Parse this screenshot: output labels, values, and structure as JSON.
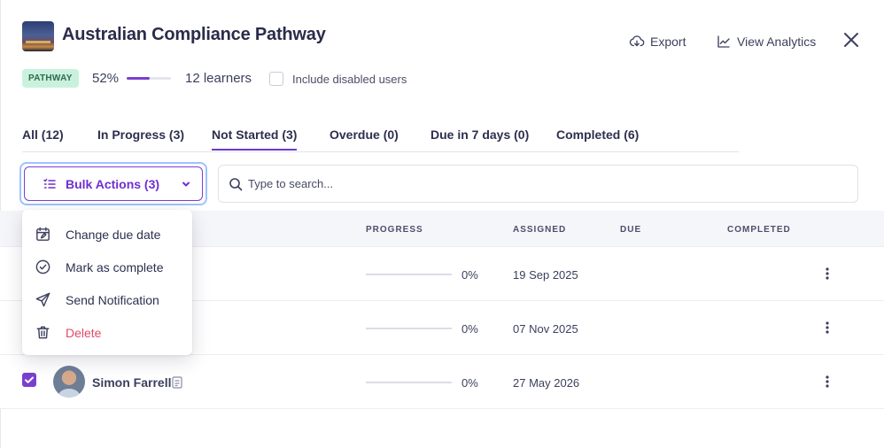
{
  "header": {
    "title": "Australian Compliance Pathway",
    "export_label": "Export",
    "analytics_label": "View Analytics"
  },
  "summary": {
    "badge": "PATHWAY",
    "progress_text": "52%",
    "progress_fraction": 0.52,
    "learners": "12 learners",
    "include_disabled_label": "Include disabled users",
    "include_disabled_checked": false
  },
  "tabs": [
    {
      "label": "All (12)"
    },
    {
      "label": "In Progress (3)"
    },
    {
      "label": "Not Started (3)",
      "active": true
    },
    {
      "label": "Overdue (0)"
    },
    {
      "label": "Due in 7 days (0)"
    },
    {
      "label": "Completed (6)"
    }
  ],
  "toolbar": {
    "bulk_label": "Bulk Actions (3)",
    "search_placeholder": "Type to search..."
  },
  "table": {
    "columns": [
      "PROGRESS",
      "ASSIGNED",
      "DUE",
      "COMPLETED"
    ],
    "rows": [
      {
        "name": "",
        "progress": "0%",
        "assigned": "19 Sep 2025",
        "due": "",
        "completed": ""
      },
      {
        "name": "",
        "progress": "0%",
        "assigned": "07 Nov 2025",
        "due": "",
        "completed": ""
      },
      {
        "name": "Simon Farrell",
        "progress": "0%",
        "assigned": "27 May 2026",
        "due": "",
        "completed": "",
        "checked": true
      }
    ]
  },
  "bulk_menu": {
    "items": [
      {
        "label": "Change due date",
        "icon": "calendar-edit-icon"
      },
      {
        "label": "Mark as complete",
        "icon": "check-circle-icon"
      },
      {
        "label": "Send Notification",
        "icon": "send-icon"
      },
      {
        "label": "Delete",
        "icon": "trash-icon",
        "danger": true
      }
    ]
  },
  "colors": {
    "accent": "#7b3fcf",
    "danger": "#e04a6a",
    "badge_bg": "#c9f1de"
  }
}
